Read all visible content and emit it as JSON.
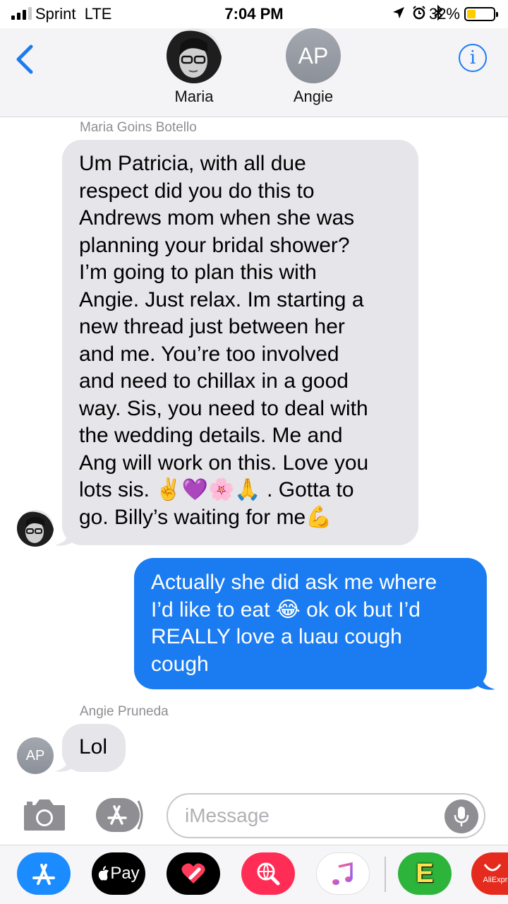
{
  "status_bar": {
    "carrier": "Sprint",
    "network": "LTE",
    "time": "7:04 PM",
    "battery_percent": "32%",
    "battery_level": 0.32,
    "icons": [
      "location-icon",
      "alarm-icon",
      "bluetooth-icon"
    ]
  },
  "header": {
    "back_icon": "chevron-left-icon",
    "contacts": [
      {
        "name": "Maria",
        "avatar": "photo"
      },
      {
        "name": "Angie",
        "avatar_initials": "AP"
      }
    ],
    "info_glyph": "i"
  },
  "messages": [
    {
      "direction": "incoming",
      "sender": "Maria Goins Botello",
      "lines": [
        "Um Patricia, with all due",
        "respect did you do this to",
        "Andrews mom when she was",
        "planning your bridal shower?",
        "I’m going to plan this with",
        "Angie. Just relax. Im starting a",
        "new thread just between her",
        "and me. You’re too involved",
        "and need to chillax in a good",
        "way. Sis, you need to deal with",
        "the wedding details. Me and",
        "Ang will work on this. Love you",
        "lots sis. ✌️💜🌸🙏 . Gotta to",
        "go. Billy’s waiting for me💪"
      ]
    },
    {
      "direction": "outgoing",
      "lines": [
        "Actually she did ask me where",
        "I’d like to eat 😂 ok ok but I’d",
        "REALLY love a luau cough",
        "cough"
      ]
    },
    {
      "direction": "incoming",
      "sender": "Angie Pruneda",
      "avatar_initials": "AP",
      "lines": [
        "Lol"
      ]
    }
  ],
  "input_bar": {
    "placeholder": "iMessage",
    "value": ""
  },
  "app_drawer": {
    "apps": [
      {
        "name": "App Store",
        "icon": "app-store-icon",
        "color": "#1a8cff"
      },
      {
        "name": "Apple Pay",
        "label": "Pay",
        "icon": "apple-pay-icon",
        "color": "#000000"
      },
      {
        "name": "Digital Touch",
        "icon": "digital-touch-icon",
        "color": "#000000"
      },
      {
        "name": "Web Search",
        "icon": "globe-search-icon",
        "color": "#ff2d55"
      },
      {
        "name": "Music",
        "icon": "music-icon",
        "color": "#ffffff"
      },
      {
        "name": "Fandango",
        "label": "E",
        "icon": "fandango-icon",
        "color": "#2db43a"
      },
      {
        "name": "AliExpress",
        "label": "AliExpre",
        "icon": "aliexpress-icon",
        "color": "#e52b1d"
      }
    ]
  },
  "colors": {
    "accent": "#1b7cf2",
    "incoming_bubble": "#e5e5ea",
    "outgoing_bubble": "#1b7cf2",
    "meta_text": "#8e8e93"
  }
}
